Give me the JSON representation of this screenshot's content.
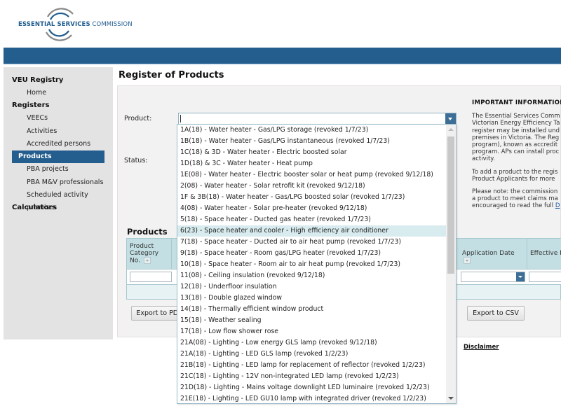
{
  "header": {
    "logo_strong": "ESSENTIAL SERVICES",
    "logo_light": "COMMISSION",
    "brand_color": "#245e8e"
  },
  "sidebar": {
    "sections": [
      {
        "heading": "VEU Registry",
        "items": [
          {
            "label": "Home",
            "active": false
          }
        ]
      },
      {
        "heading": "Registers",
        "items": [
          {
            "label": "VEECs",
            "active": false
          },
          {
            "label": "Activities",
            "active": false
          },
          {
            "label": "Accredited persons",
            "active": false
          },
          {
            "label": "Products",
            "active": true
          },
          {
            "label": "PBA projects",
            "active": false
          },
          {
            "label": "PBA M&V professionals",
            "active": false
          },
          {
            "label": "Scheduled activity premises",
            "active": false
          }
        ]
      },
      {
        "heading": "Calculators",
        "items": []
      }
    ]
  },
  "main": {
    "title": "Register of Products",
    "product_label": "Product:",
    "product_value": "",
    "status_label": "Status:",
    "info": {
      "heading": "IMPORTANT INFORMATION",
      "para1": [
        "The Essential Services Comm",
        "Victorian Energy Efficiency Ta",
        "register may be installed und",
        "premises in Victoria. The Reg",
        "program), known as accredit",
        "program. APs can install proc",
        "activity."
      ],
      "para2": [
        "To add a product to the regis",
        "Product Applicants for more"
      ],
      "para3": [
        "Please note: the commission",
        "a product to meet claims ma",
        "encouraged to read the full "
      ],
      "para3_link": "D"
    },
    "products_heading": "Products",
    "grid": {
      "columns": [
        {
          "label": "Product Category No.",
          "filter": "text"
        },
        {
          "label": "Application Date",
          "filter": "select"
        },
        {
          "label": "Effective F",
          "filter": "text"
        }
      ]
    },
    "export_pdf": "Export to PDF",
    "export_csv": "Export to CSV",
    "disclaimer": "Disclaimer"
  },
  "dropdown": {
    "hovered_index": 9,
    "scroll_position": 0,
    "options": [
      "1A(18) - Water heater - Gas/LPG storage (revoked 1/7/23)",
      "1B(18) - Water heater - Gas/LPG instantaneous (revoked 1/7/23)",
      "1C(18) & 3D - Water heater - Electric boosted solar",
      "1D(18) & 3C - Water heater - Heat pump",
      "1E(08) - Water heater - Electric booster solar or heat pump (revoked 9/12/18)",
      "2(08) - Water heater - Solar retrofit kit (revoked 9/12/18)",
      "1F & 3B(18) - Water heater - Gas/LPG boosted solar (revoked 1/7/23)",
      "4(08) - Water heater - Solar pre-heater (revoked 9/12/18)",
      "5(18) - Space heater - Ducted gas heater (revoked 1/7/23)",
      "6(23) - Space heater and cooler - High efficiency air conditioner",
      "7(18) - Space heater - Ducted air to air heat pump (revoked 1/7/23)",
      "9(18) - Space heater - Room gas/LPG heater (revoked 1/7/23)",
      "10(18) - Space heater - Room air to air heat pump (revoked 1/7/23)",
      "11(08) - Ceiling insulation (revoked 9/12/18)",
      "12(18) - Underfloor insulation",
      "13(18) - Double glazed window",
      "14(18) - Thermally efficient window product",
      "15(18) - Weather sealing",
      "17(18) - Low flow shower rose",
      "21A(08) - Lighting - Low energy GLS lamp (revoked 9/12/18)",
      "21A(18) - Lighting - LED GLS lamp (revoked 1/2/23)",
      "21B(18) - Lighting - LED lamp for replacement of reflector (revoked 1/2/23)",
      "21C(18) - Lighting - 12V non-integrated LED lamp (revoked 1/2/23)",
      "21D(18) - Lighting - Mains voltage downlight LED luminaire (revoked 1/2/23)",
      "21E(18) - Lighting - LED GU10 lamp with integrated driver (revoked 1/2/23)"
    ]
  }
}
